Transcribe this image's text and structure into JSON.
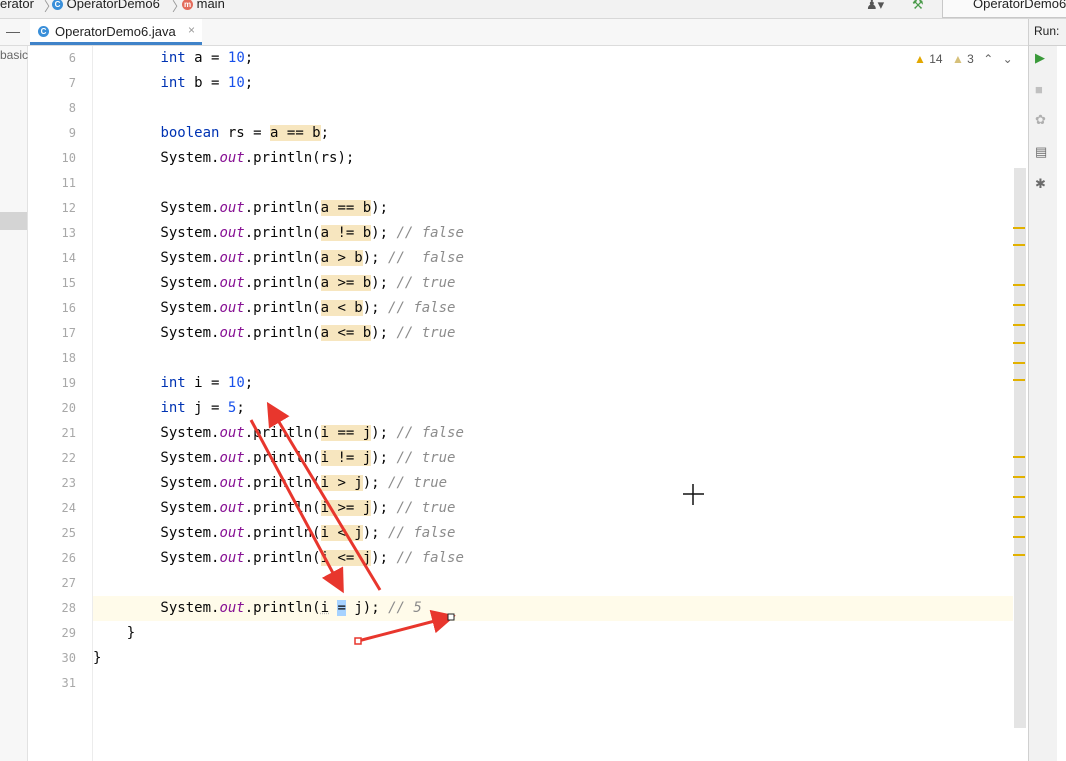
{
  "breadcrumb": {
    "project": "erator",
    "class_name": "OperatorDemo6",
    "method": "main",
    "class_badge": "C",
    "method_badge": "m"
  },
  "toolbar": {
    "run_config": "OperatorDemo6"
  },
  "tab": {
    "label": "OperatorDemo6.java",
    "badge": "C",
    "close": "×"
  },
  "run_panel": {
    "title": "Run:"
  },
  "project_panel": {
    "fragment": "basic"
  },
  "inspections": {
    "warnings": "14",
    "weak_warnings": "3"
  },
  "icons": [
    "collapse-icon",
    "user-icon",
    "hammer-icon",
    "play-icon",
    "stop-icon",
    "debug-icon",
    "layout-icon",
    "pin-icon",
    "bulb-icon",
    "fold-icon",
    "chevron-up-icon",
    "chevron-down-icon",
    "crosshair-cursor-icon"
  ],
  "colors": {
    "keyword": "#0033b3",
    "number": "#1750eb",
    "field": "#871094",
    "comment": "#8c8c8c",
    "highlight": "#f7e6bf",
    "selection": "#a6d2ff",
    "annotation": "#e8362d"
  },
  "line_numbers": [
    "6",
    "7",
    "8",
    "9",
    "10",
    "11",
    "12",
    "13",
    "14",
    "15",
    "16",
    "17",
    "18",
    "19",
    "20",
    "21",
    "22",
    "23",
    "24",
    "25",
    "26",
    "27",
    "28",
    "29",
    "30",
    "31"
  ],
  "code_lines": [
    {
      "num": "6",
      "tokens": [
        {
          "t": "        "
        },
        {
          "t": "int",
          "c": "kw"
        },
        {
          "t": " a = "
        },
        {
          "t": "10",
          "c": "num"
        },
        {
          "t": ";"
        }
      ]
    },
    {
      "num": "7",
      "tokens": [
        {
          "t": "        "
        },
        {
          "t": "int",
          "c": "kw"
        },
        {
          "t": " b = "
        },
        {
          "t": "10",
          "c": "num"
        },
        {
          "t": ";"
        }
      ]
    },
    {
      "num": "8",
      "tokens": []
    },
    {
      "num": "9",
      "tokens": [
        {
          "t": "        "
        },
        {
          "t": "boolean",
          "c": "kw"
        },
        {
          "t": " rs = "
        },
        {
          "t": "a == b",
          "c": "hl"
        },
        {
          "t": ";"
        }
      ]
    },
    {
      "num": "10",
      "tokens": [
        {
          "t": "        System."
        },
        {
          "t": "out",
          "c": "fld"
        },
        {
          "t": ".println(rs);"
        }
      ]
    },
    {
      "num": "11",
      "tokens": []
    },
    {
      "num": "12",
      "tokens": [
        {
          "t": "        System."
        },
        {
          "t": "out",
          "c": "fld"
        },
        {
          "t": ".println("
        },
        {
          "t": "a == b",
          "c": "hl"
        },
        {
          "t": ");"
        }
      ]
    },
    {
      "num": "13",
      "tokens": [
        {
          "t": "        System."
        },
        {
          "t": "out",
          "c": "fld"
        },
        {
          "t": ".println("
        },
        {
          "t": "a != b",
          "c": "hl"
        },
        {
          "t": "); "
        },
        {
          "t": "// false",
          "c": "cmt"
        }
      ]
    },
    {
      "num": "14",
      "tokens": [
        {
          "t": "        System."
        },
        {
          "t": "out",
          "c": "fld"
        },
        {
          "t": ".println("
        },
        {
          "t": "a > b",
          "c": "hl"
        },
        {
          "t": "); "
        },
        {
          "t": "//  false",
          "c": "cmt"
        }
      ]
    },
    {
      "num": "15",
      "tokens": [
        {
          "t": "        System."
        },
        {
          "t": "out",
          "c": "fld"
        },
        {
          "t": ".println("
        },
        {
          "t": "a >= b",
          "c": "hl"
        },
        {
          "t": "); "
        },
        {
          "t": "// true",
          "c": "cmt"
        }
      ]
    },
    {
      "num": "16",
      "tokens": [
        {
          "t": "        System."
        },
        {
          "t": "out",
          "c": "fld"
        },
        {
          "t": ".println("
        },
        {
          "t": "a < b",
          "c": "hl"
        },
        {
          "t": "); "
        },
        {
          "t": "// false",
          "c": "cmt"
        }
      ]
    },
    {
      "num": "17",
      "tokens": [
        {
          "t": "        System."
        },
        {
          "t": "out",
          "c": "fld"
        },
        {
          "t": ".println("
        },
        {
          "t": "a <= b",
          "c": "hl"
        },
        {
          "t": "); "
        },
        {
          "t": "// true",
          "c": "cmt"
        }
      ]
    },
    {
      "num": "18",
      "tokens": []
    },
    {
      "num": "19",
      "tokens": [
        {
          "t": "        "
        },
        {
          "t": "int",
          "c": "kw"
        },
        {
          "t": " i = "
        },
        {
          "t": "10",
          "c": "num"
        },
        {
          "t": ";"
        }
      ]
    },
    {
      "num": "20",
      "tokens": [
        {
          "t": "        "
        },
        {
          "t": "int",
          "c": "kw"
        },
        {
          "t": " j = "
        },
        {
          "t": "5",
          "c": "num"
        },
        {
          "t": ";"
        }
      ]
    },
    {
      "num": "21",
      "tokens": [
        {
          "t": "        System."
        },
        {
          "t": "out",
          "c": "fld"
        },
        {
          "t": ".println("
        },
        {
          "t": "i == j",
          "c": "hl"
        },
        {
          "t": "); "
        },
        {
          "t": "// false",
          "c": "cmt"
        }
      ]
    },
    {
      "num": "22",
      "tokens": [
        {
          "t": "        System."
        },
        {
          "t": "out",
          "c": "fld"
        },
        {
          "t": ".println("
        },
        {
          "t": "i != j",
          "c": "hl"
        },
        {
          "t": "); "
        },
        {
          "t": "// true",
          "c": "cmt"
        }
      ]
    },
    {
      "num": "23",
      "tokens": [
        {
          "t": "        System."
        },
        {
          "t": "out",
          "c": "fld"
        },
        {
          "t": ".println("
        },
        {
          "t": "i > j",
          "c": "hl"
        },
        {
          "t": "); "
        },
        {
          "t": "// true",
          "c": "cmt"
        }
      ]
    },
    {
      "num": "24",
      "tokens": [
        {
          "t": "        System."
        },
        {
          "t": "out",
          "c": "fld"
        },
        {
          "t": ".println("
        },
        {
          "t": "i >= j",
          "c": "hl"
        },
        {
          "t": "); "
        },
        {
          "t": "// true",
          "c": "cmt"
        }
      ]
    },
    {
      "num": "25",
      "tokens": [
        {
          "t": "        System."
        },
        {
          "t": "out",
          "c": "fld"
        },
        {
          "t": ".println("
        },
        {
          "t": "i < j",
          "c": "hl"
        },
        {
          "t": "); "
        },
        {
          "t": "// false",
          "c": "cmt"
        }
      ]
    },
    {
      "num": "26",
      "tokens": [
        {
          "t": "        System."
        },
        {
          "t": "out",
          "c": "fld"
        },
        {
          "t": ".println("
        },
        {
          "t": "i <= j",
          "c": "hl"
        },
        {
          "t": "); "
        },
        {
          "t": "// false",
          "c": "cmt"
        }
      ]
    },
    {
      "num": "27",
      "tokens": []
    },
    {
      "num": "28",
      "current": true,
      "tokens": [
        {
          "t": "        System."
        },
        {
          "t": "out",
          "c": "fld"
        },
        {
          "t": ".println("
        },
        {
          "t": "i",
          "c": "wavy"
        },
        {
          "t": " "
        },
        {
          "t": "=",
          "c": "sel"
        },
        {
          "t": " j); "
        },
        {
          "t": "// 5",
          "c": "cmt"
        }
      ]
    },
    {
      "num": "29",
      "tokens": [
        {
          "t": "    }"
        }
      ]
    },
    {
      "num": "30",
      "tokens": [
        {
          "t": "}"
        }
      ]
    },
    {
      "num": "31",
      "tokens": []
    }
  ],
  "stripe_marks": 14
}
